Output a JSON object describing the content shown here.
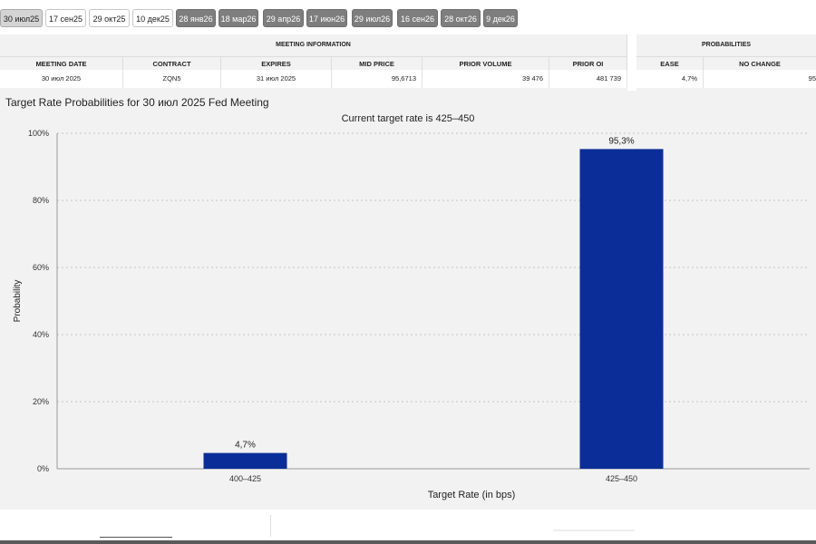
{
  "tabs": [
    {
      "label": "30 июл25",
      "style": "selected"
    },
    {
      "label": "17 сен25",
      "style": "light"
    },
    {
      "label": "29 окт25",
      "style": "light"
    },
    {
      "label": "10 дек25",
      "style": "light"
    },
    {
      "label": "28 янв26",
      "style": "dark"
    },
    {
      "label": "18 мар26",
      "style": "dark"
    },
    {
      "label": "29 апр26",
      "style": "dark"
    },
    {
      "label": "17 июн26",
      "style": "dark"
    },
    {
      "label": "29 июл26",
      "style": "dark"
    },
    {
      "label": "16 сен26",
      "style": "dark"
    },
    {
      "label": "28 окт26",
      "style": "dark"
    },
    {
      "label": "9 дек26",
      "style": "dark"
    }
  ],
  "table": {
    "group_meeting": "MEETING INFORMATION",
    "group_prob": "PROBABILITIES",
    "headers": [
      "MEETING DATE",
      "CONTRACT",
      "EXPIRES",
      "MID PRICE",
      "PRIOR VOLUME",
      "PRIOR OI",
      "EASE",
      "NO CHANGE"
    ],
    "row": [
      "30 июл 2025",
      "ZQN5",
      "31 июл 2025",
      "95,6713",
      "39 476",
      "481 739",
      "4,7%",
      "95"
    ]
  },
  "chart_data": {
    "type": "bar",
    "title": "Target Rate Probabilities for 30 июл 2025 Fed Meeting",
    "subtitle": "Current target rate is 425–450",
    "xlabel": "Target Rate (in bps)",
    "ylabel": "Probability",
    "categories": [
      "400–425",
      "425–450"
    ],
    "values": [
      4.7,
      95.3
    ],
    "value_labels": [
      "4,7%",
      "95,3%"
    ],
    "yticks": [
      "0%",
      "20%",
      "40%",
      "60%",
      "80%",
      "100%"
    ],
    "ylim": [
      0,
      100
    ],
    "grid": true,
    "bar_color": "#0b2d97"
  }
}
